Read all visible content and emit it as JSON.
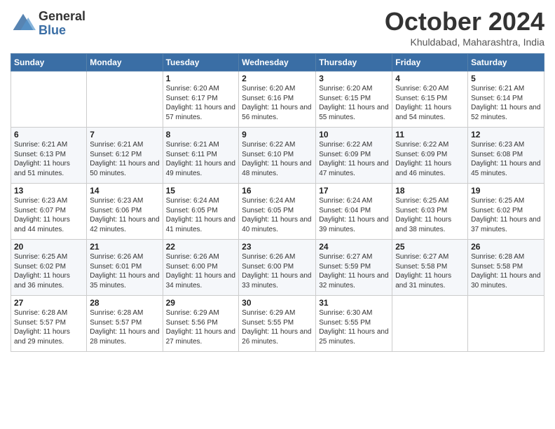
{
  "logo": {
    "general": "General",
    "blue": "Blue"
  },
  "header": {
    "month": "October 2024",
    "location": "Khuldabad, Maharashtra, India"
  },
  "days_of_week": [
    "Sunday",
    "Monday",
    "Tuesday",
    "Wednesday",
    "Thursday",
    "Friday",
    "Saturday"
  ],
  "weeks": [
    [
      {
        "day": "",
        "sunrise": "",
        "sunset": "",
        "daylight": ""
      },
      {
        "day": "",
        "sunrise": "",
        "sunset": "",
        "daylight": ""
      },
      {
        "day": "1",
        "sunrise": "Sunrise: 6:20 AM",
        "sunset": "Sunset: 6:17 PM",
        "daylight": "Daylight: 11 hours and 57 minutes."
      },
      {
        "day": "2",
        "sunrise": "Sunrise: 6:20 AM",
        "sunset": "Sunset: 6:16 PM",
        "daylight": "Daylight: 11 hours and 56 minutes."
      },
      {
        "day": "3",
        "sunrise": "Sunrise: 6:20 AM",
        "sunset": "Sunset: 6:15 PM",
        "daylight": "Daylight: 11 hours and 55 minutes."
      },
      {
        "day": "4",
        "sunrise": "Sunrise: 6:20 AM",
        "sunset": "Sunset: 6:15 PM",
        "daylight": "Daylight: 11 hours and 54 minutes."
      },
      {
        "day": "5",
        "sunrise": "Sunrise: 6:21 AM",
        "sunset": "Sunset: 6:14 PM",
        "daylight": "Daylight: 11 hours and 52 minutes."
      }
    ],
    [
      {
        "day": "6",
        "sunrise": "Sunrise: 6:21 AM",
        "sunset": "Sunset: 6:13 PM",
        "daylight": "Daylight: 11 hours and 51 minutes."
      },
      {
        "day": "7",
        "sunrise": "Sunrise: 6:21 AM",
        "sunset": "Sunset: 6:12 PM",
        "daylight": "Daylight: 11 hours and 50 minutes."
      },
      {
        "day": "8",
        "sunrise": "Sunrise: 6:21 AM",
        "sunset": "Sunset: 6:11 PM",
        "daylight": "Daylight: 11 hours and 49 minutes."
      },
      {
        "day": "9",
        "sunrise": "Sunrise: 6:22 AM",
        "sunset": "Sunset: 6:10 PM",
        "daylight": "Daylight: 11 hours and 48 minutes."
      },
      {
        "day": "10",
        "sunrise": "Sunrise: 6:22 AM",
        "sunset": "Sunset: 6:09 PM",
        "daylight": "Daylight: 11 hours and 47 minutes."
      },
      {
        "day": "11",
        "sunrise": "Sunrise: 6:22 AM",
        "sunset": "Sunset: 6:09 PM",
        "daylight": "Daylight: 11 hours and 46 minutes."
      },
      {
        "day": "12",
        "sunrise": "Sunrise: 6:23 AM",
        "sunset": "Sunset: 6:08 PM",
        "daylight": "Daylight: 11 hours and 45 minutes."
      }
    ],
    [
      {
        "day": "13",
        "sunrise": "Sunrise: 6:23 AM",
        "sunset": "Sunset: 6:07 PM",
        "daylight": "Daylight: 11 hours and 44 minutes."
      },
      {
        "day": "14",
        "sunrise": "Sunrise: 6:23 AM",
        "sunset": "Sunset: 6:06 PM",
        "daylight": "Daylight: 11 hours and 42 minutes."
      },
      {
        "day": "15",
        "sunrise": "Sunrise: 6:24 AM",
        "sunset": "Sunset: 6:05 PM",
        "daylight": "Daylight: 11 hours and 41 minutes."
      },
      {
        "day": "16",
        "sunrise": "Sunrise: 6:24 AM",
        "sunset": "Sunset: 6:05 PM",
        "daylight": "Daylight: 11 hours and 40 minutes."
      },
      {
        "day": "17",
        "sunrise": "Sunrise: 6:24 AM",
        "sunset": "Sunset: 6:04 PM",
        "daylight": "Daylight: 11 hours and 39 minutes."
      },
      {
        "day": "18",
        "sunrise": "Sunrise: 6:25 AM",
        "sunset": "Sunset: 6:03 PM",
        "daylight": "Daylight: 11 hours and 38 minutes."
      },
      {
        "day": "19",
        "sunrise": "Sunrise: 6:25 AM",
        "sunset": "Sunset: 6:02 PM",
        "daylight": "Daylight: 11 hours and 37 minutes."
      }
    ],
    [
      {
        "day": "20",
        "sunrise": "Sunrise: 6:25 AM",
        "sunset": "Sunset: 6:02 PM",
        "daylight": "Daylight: 11 hours and 36 minutes."
      },
      {
        "day": "21",
        "sunrise": "Sunrise: 6:26 AM",
        "sunset": "Sunset: 6:01 PM",
        "daylight": "Daylight: 11 hours and 35 minutes."
      },
      {
        "day": "22",
        "sunrise": "Sunrise: 6:26 AM",
        "sunset": "Sunset: 6:00 PM",
        "daylight": "Daylight: 11 hours and 34 minutes."
      },
      {
        "day": "23",
        "sunrise": "Sunrise: 6:26 AM",
        "sunset": "Sunset: 6:00 PM",
        "daylight": "Daylight: 11 hours and 33 minutes."
      },
      {
        "day": "24",
        "sunrise": "Sunrise: 6:27 AM",
        "sunset": "Sunset: 5:59 PM",
        "daylight": "Daylight: 11 hours and 32 minutes."
      },
      {
        "day": "25",
        "sunrise": "Sunrise: 6:27 AM",
        "sunset": "Sunset: 5:58 PM",
        "daylight": "Daylight: 11 hours and 31 minutes."
      },
      {
        "day": "26",
        "sunrise": "Sunrise: 6:28 AM",
        "sunset": "Sunset: 5:58 PM",
        "daylight": "Daylight: 11 hours and 30 minutes."
      }
    ],
    [
      {
        "day": "27",
        "sunrise": "Sunrise: 6:28 AM",
        "sunset": "Sunset: 5:57 PM",
        "daylight": "Daylight: 11 hours and 29 minutes."
      },
      {
        "day": "28",
        "sunrise": "Sunrise: 6:28 AM",
        "sunset": "Sunset: 5:57 PM",
        "daylight": "Daylight: 11 hours and 28 minutes."
      },
      {
        "day": "29",
        "sunrise": "Sunrise: 6:29 AM",
        "sunset": "Sunset: 5:56 PM",
        "daylight": "Daylight: 11 hours and 27 minutes."
      },
      {
        "day": "30",
        "sunrise": "Sunrise: 6:29 AM",
        "sunset": "Sunset: 5:55 PM",
        "daylight": "Daylight: 11 hours and 26 minutes."
      },
      {
        "day": "31",
        "sunrise": "Sunrise: 6:30 AM",
        "sunset": "Sunset: 5:55 PM",
        "daylight": "Daylight: 11 hours and 25 minutes."
      },
      {
        "day": "",
        "sunrise": "",
        "sunset": "",
        "daylight": ""
      },
      {
        "day": "",
        "sunrise": "",
        "sunset": "",
        "daylight": ""
      }
    ]
  ]
}
